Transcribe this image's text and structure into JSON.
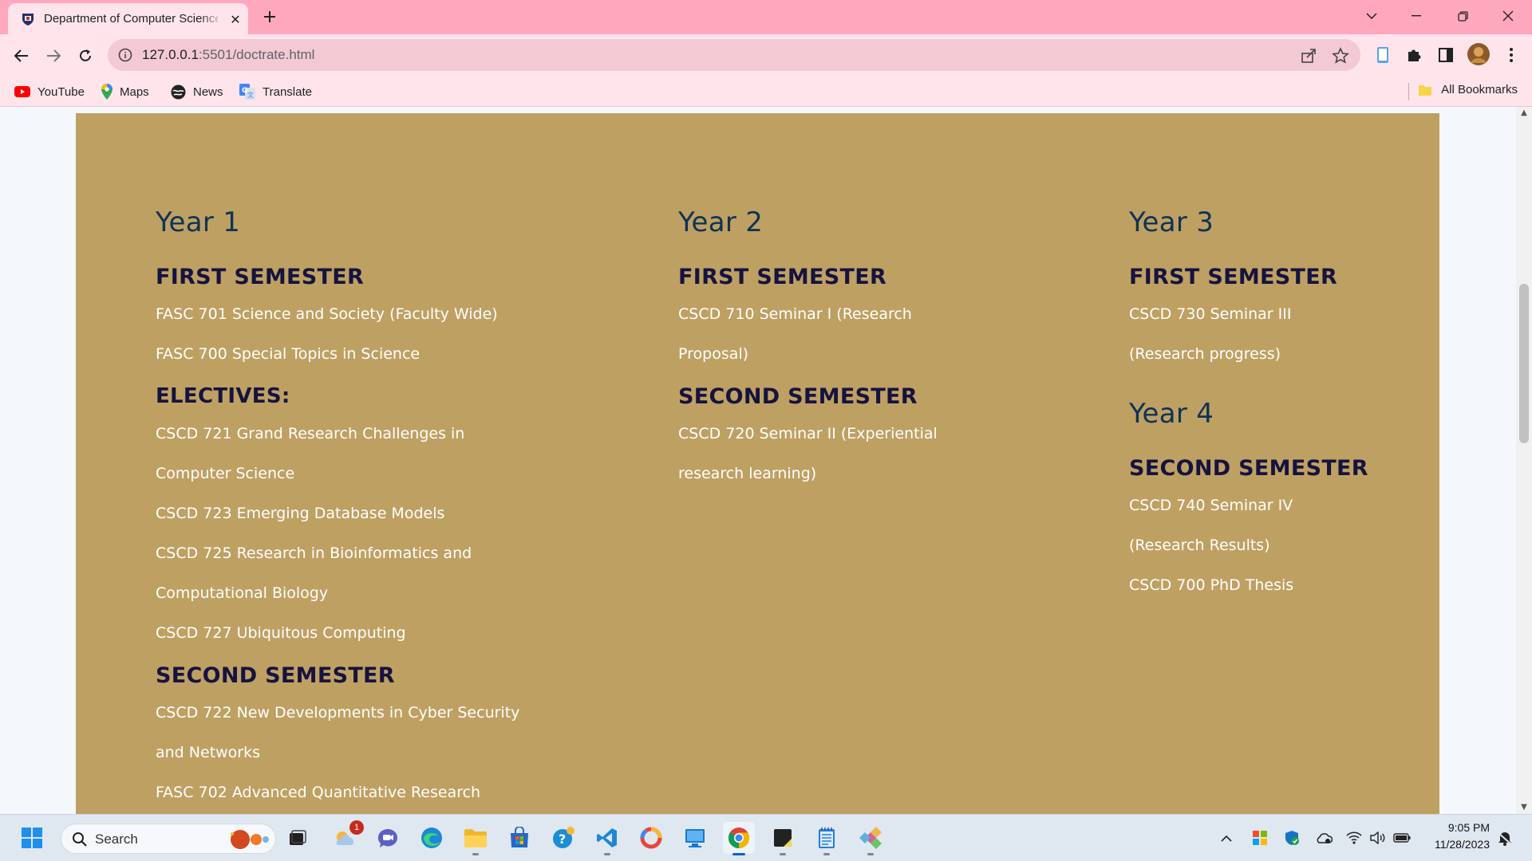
{
  "browser": {
    "tab_title": "Department of Computer Science",
    "url_host": "127.0.0.1",
    "url_path": ":5501/doctrate.html",
    "bookmarks": [
      {
        "label": "YouTube",
        "icon": "youtube-icon"
      },
      {
        "label": "Maps",
        "icon": "maps-icon"
      },
      {
        "label": "News",
        "icon": "news-icon"
      },
      {
        "label": "Translate",
        "icon": "translate-icon"
      }
    ],
    "all_bookmarks_label": "All Bookmarks"
  },
  "page": {
    "panel_color": "#bfa063",
    "columns": [
      {
        "year": "Year 1",
        "sections": [
          {
            "heading": "FIRST SEMESTER",
            "items": [
              "FASC 701 Science and Society (Faculty Wide)",
              "FASC 700 Special Topics in Science"
            ]
          },
          {
            "heading": "ELECTIVES:",
            "items": [
              "CSCD 721 Grand Research Challenges in",
              "Computer Science",
              "CSCD 723 Emerging Database Models",
              "CSCD 725 Research in Bioinformatics and",
              "Computational Biology",
              "CSCD 727 Ubiquitous Computing"
            ]
          },
          {
            "heading": "SECOND SEMESTER",
            "items": [
              "CSCD 722 New Developments in Cyber Security",
              "and Networks",
              "FASC 702 Advanced Quantitative Research"
            ]
          }
        ]
      },
      {
        "year": "Year 2",
        "sections": [
          {
            "heading": "FIRST SEMESTER",
            "items": [
              "CSCD 710 Seminar I (Research",
              "Proposal)"
            ]
          },
          {
            "heading": "SECOND SEMESTER",
            "items": [
              "CSCD 720 Seminar II (Experiential",
              "research learning)"
            ]
          }
        ]
      },
      {
        "year": "Year 3",
        "sections": [
          {
            "heading": "FIRST SEMESTER",
            "items": [
              "CSCD 730 Seminar III",
              "(Research progress)"
            ]
          }
        ]
      },
      {
        "year": "Year 4",
        "sections": [
          {
            "heading": "SECOND SEMESTER",
            "items": [
              "CSCD 740 Seminar IV",
              "(Research Results)",
              "CSCD 700 PhD Thesis"
            ]
          }
        ]
      }
    ]
  },
  "taskbar": {
    "search_label": "Search",
    "notification_badge": "1",
    "time": "9:05 PM",
    "date": "11/28/2023"
  }
}
